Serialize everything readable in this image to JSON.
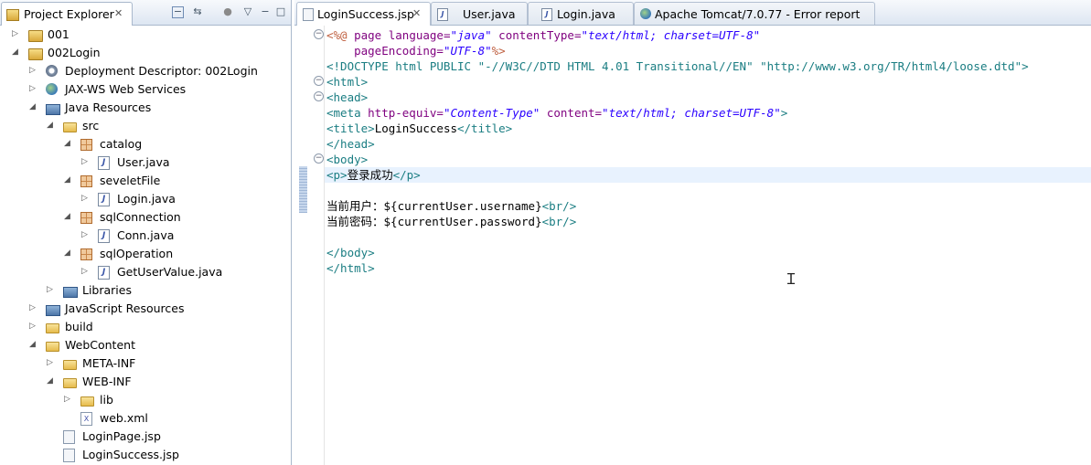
{
  "explorer": {
    "title": "Project Explorer",
    "tree": [
      {
        "label": "001",
        "icon": "project-icon",
        "twisty": "collapsed"
      },
      {
        "label": "002Login",
        "icon": "project-icon",
        "twisty": "expanded"
      },
      {
        "label": "Deployment Descriptor: 002Login",
        "icon": "deployment-descriptor-icon",
        "twisty": "collapsed"
      },
      {
        "label": "JAX-WS Web Services",
        "icon": "web-services-icon",
        "twisty": "collapsed"
      },
      {
        "label": "Java Resources",
        "icon": "java-resources-icon",
        "twisty": "expanded"
      },
      {
        "label": "src",
        "icon": "source-folder-icon",
        "twisty": "expanded"
      },
      {
        "label": "catalog",
        "icon": "package-icon",
        "twisty": "expanded"
      },
      {
        "label": "User.java",
        "icon": "java-file-icon",
        "twisty": "collapsed"
      },
      {
        "label": "seveletFile",
        "icon": "package-icon",
        "twisty": "expanded"
      },
      {
        "label": "Login.java",
        "icon": "java-file-icon",
        "twisty": "collapsed"
      },
      {
        "label": "sqlConnection",
        "icon": "package-icon",
        "twisty": "expanded"
      },
      {
        "label": "Conn.java",
        "icon": "java-file-icon",
        "twisty": "collapsed"
      },
      {
        "label": "sqlOperation",
        "icon": "package-icon",
        "twisty": "expanded"
      },
      {
        "label": "GetUserValue.java",
        "icon": "java-file-icon",
        "twisty": "collapsed"
      },
      {
        "label": "Libraries",
        "icon": "libraries-icon",
        "twisty": "collapsed"
      },
      {
        "label": "JavaScript Resources",
        "icon": "javascript-resources-icon",
        "twisty": "collapsed"
      },
      {
        "label": "build",
        "icon": "folder-icon",
        "twisty": "collapsed"
      },
      {
        "label": "WebContent",
        "icon": "folder-icon",
        "twisty": "expanded"
      },
      {
        "label": "META-INF",
        "icon": "folder-icon",
        "twisty": "collapsed"
      },
      {
        "label": "WEB-INF",
        "icon": "folder-icon",
        "twisty": "expanded"
      },
      {
        "label": "lib",
        "icon": "folder-icon",
        "twisty": "collapsed"
      },
      {
        "label": "web.xml",
        "icon": "xml-file-icon",
        "twisty": "none"
      },
      {
        "label": "LoginPage.jsp",
        "icon": "jsp-file-icon",
        "twisty": "none"
      },
      {
        "label": "LoginSuccess.jsp",
        "icon": "jsp-file-icon",
        "twisty": "none"
      }
    ]
  },
  "editor": {
    "tabs": [
      {
        "label": "LoginSuccess.jsp",
        "icon": "jsp-file-icon",
        "active": true
      },
      {
        "label": "User.java",
        "icon": "java-file-icon",
        "active": false
      },
      {
        "label": "Login.java",
        "icon": "java-file-icon",
        "active": false
      },
      {
        "label": "Apache Tomcat/7.0.77 - Error report",
        "icon": "browser-globe-icon",
        "active": false
      }
    ],
    "code_lines": [
      [
        {
          "t": "<%@ ",
          "c": "c-dir"
        },
        {
          "t": "page ",
          "c": "c-attr"
        },
        {
          "t": "language=",
          "c": "c-attr"
        },
        {
          "t": "\"java\"",
          "c": "c-val"
        },
        {
          "t": " contentType=",
          "c": "c-attr"
        },
        {
          "t": "\"text/html; charset=UTF-8\"",
          "c": "c-val"
        }
      ],
      [
        {
          "t": "    pageEncoding=",
          "c": "c-attr"
        },
        {
          "t": "\"UTF-8\"",
          "c": "c-val"
        },
        {
          "t": "%>",
          "c": "c-dir"
        }
      ],
      [
        {
          "t": "<!DOCTYPE html PUBLIC ",
          "c": "c-doc"
        },
        {
          "t": "\"-//W3C//DTD HTML 4.01 Transitional//EN\" \"http://www.w3.org/TR/html4/loose.dtd\"",
          "c": "c-doc"
        },
        {
          "t": ">",
          "c": "c-doc"
        }
      ],
      [
        {
          "t": "<html>",
          "c": "c-tag"
        }
      ],
      [
        {
          "t": "<head>",
          "c": "c-tag"
        }
      ],
      [
        {
          "t": "<meta ",
          "c": "c-tag"
        },
        {
          "t": "http-equiv=",
          "c": "c-attr"
        },
        {
          "t": "\"Content-Type\"",
          "c": "c-val"
        },
        {
          "t": " content=",
          "c": "c-attr"
        },
        {
          "t": "\"text/html; charset=UTF-8\"",
          "c": "c-val"
        },
        {
          "t": ">",
          "c": "c-tag"
        }
      ],
      [
        {
          "t": "<title>",
          "c": "c-tag"
        },
        {
          "t": "LoginSuccess",
          "c": "c-text"
        },
        {
          "t": "</title>",
          "c": "c-tag"
        }
      ],
      [
        {
          "t": "</head>",
          "c": "c-tag"
        }
      ],
      [
        {
          "t": "<body>",
          "c": "c-tag"
        }
      ],
      [
        {
          "t": "<p>",
          "c": "c-tag"
        },
        {
          "t": "登录成功",
          "c": "c-text"
        },
        {
          "t": "</p>",
          "c": "c-tag"
        }
      ],
      [],
      [
        {
          "t": "当前用户：",
          "c": "c-text"
        },
        {
          "t": "${currentUser.username}",
          "c": "c-el"
        },
        {
          "t": "<br/>",
          "c": "c-tag"
        }
      ],
      [
        {
          "t": "当前密码：",
          "c": "c-text"
        },
        {
          "t": "${currentUser.password}",
          "c": "c-el"
        },
        {
          "t": "<br/>",
          "c": "c-tag"
        }
      ],
      [],
      [
        {
          "t": "</body>",
          "c": "c-tag"
        }
      ],
      [
        {
          "t": "</html>",
          "c": "c-tag"
        }
      ]
    ],
    "current_line_index": 9
  }
}
